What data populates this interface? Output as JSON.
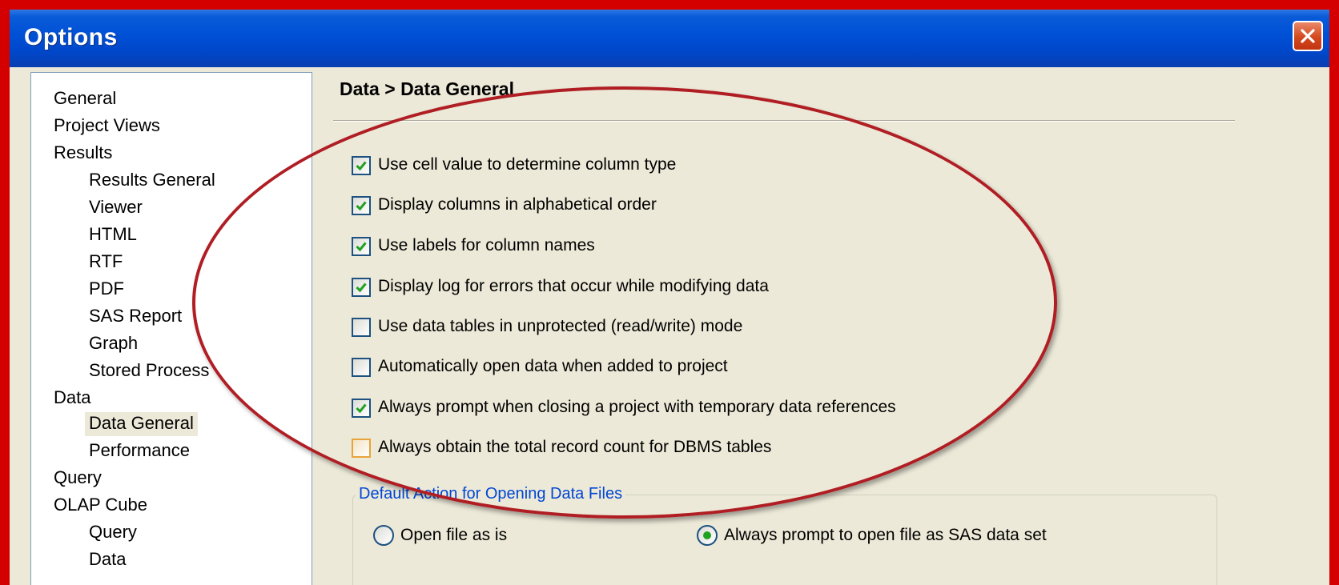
{
  "window": {
    "title": "Options"
  },
  "nav": {
    "items": [
      {
        "label": "General",
        "level": 0,
        "selected": false
      },
      {
        "label": "Project Views",
        "level": 0,
        "selected": false
      },
      {
        "label": "Results",
        "level": 0,
        "selected": false
      },
      {
        "label": "Results General",
        "level": 1,
        "selected": false
      },
      {
        "label": "Viewer",
        "level": 1,
        "selected": false
      },
      {
        "label": "HTML",
        "level": 1,
        "selected": false
      },
      {
        "label": "RTF",
        "level": 1,
        "selected": false
      },
      {
        "label": "PDF",
        "level": 1,
        "selected": false
      },
      {
        "label": "SAS Report",
        "level": 1,
        "selected": false
      },
      {
        "label": "Graph",
        "level": 1,
        "selected": false
      },
      {
        "label": "Stored Process",
        "level": 1,
        "selected": false
      },
      {
        "label": "Data",
        "level": 0,
        "selected": false
      },
      {
        "label": "Data General",
        "level": 1,
        "selected": true
      },
      {
        "label": "Performance",
        "level": 1,
        "selected": false
      },
      {
        "label": "Query",
        "level": 0,
        "selected": false
      },
      {
        "label": "OLAP Cube",
        "level": 0,
        "selected": false
      },
      {
        "label": "Query",
        "level": 1,
        "selected": false
      },
      {
        "label": "Data",
        "level": 1,
        "selected": false
      }
    ]
  },
  "content": {
    "heading": "Data > Data General",
    "options": [
      {
        "label": "Use cell value to determine column type",
        "checked": true
      },
      {
        "label": "Display columns in alphabetical order",
        "checked": true
      },
      {
        "label": "Use labels for column names",
        "checked": true
      },
      {
        "label": "Display log for errors that occur while modifying data",
        "checked": true
      },
      {
        "label": "Use data tables in unprotected (read/write) mode",
        "checked": false
      },
      {
        "label": "Automatically open data when added to project",
        "checked": false
      },
      {
        "label": "Always prompt when closing a project with temporary data references",
        "checked": true
      },
      {
        "label": "Always obtain the total record count for DBMS tables",
        "checked": false
      }
    ],
    "default_action": {
      "label": "Default Action for Opening Data Files",
      "choices": [
        {
          "label": "Open file as is",
          "selected": false
        },
        {
          "label": "Always prompt to open file as SAS data set",
          "selected": true
        }
      ]
    }
  },
  "colors": {
    "titlebar": "#0050d6",
    "window_bg": "#ece9d8",
    "annotation_red": "#b01e24",
    "group_label": "#0046d5",
    "check_green": "#21a121"
  }
}
